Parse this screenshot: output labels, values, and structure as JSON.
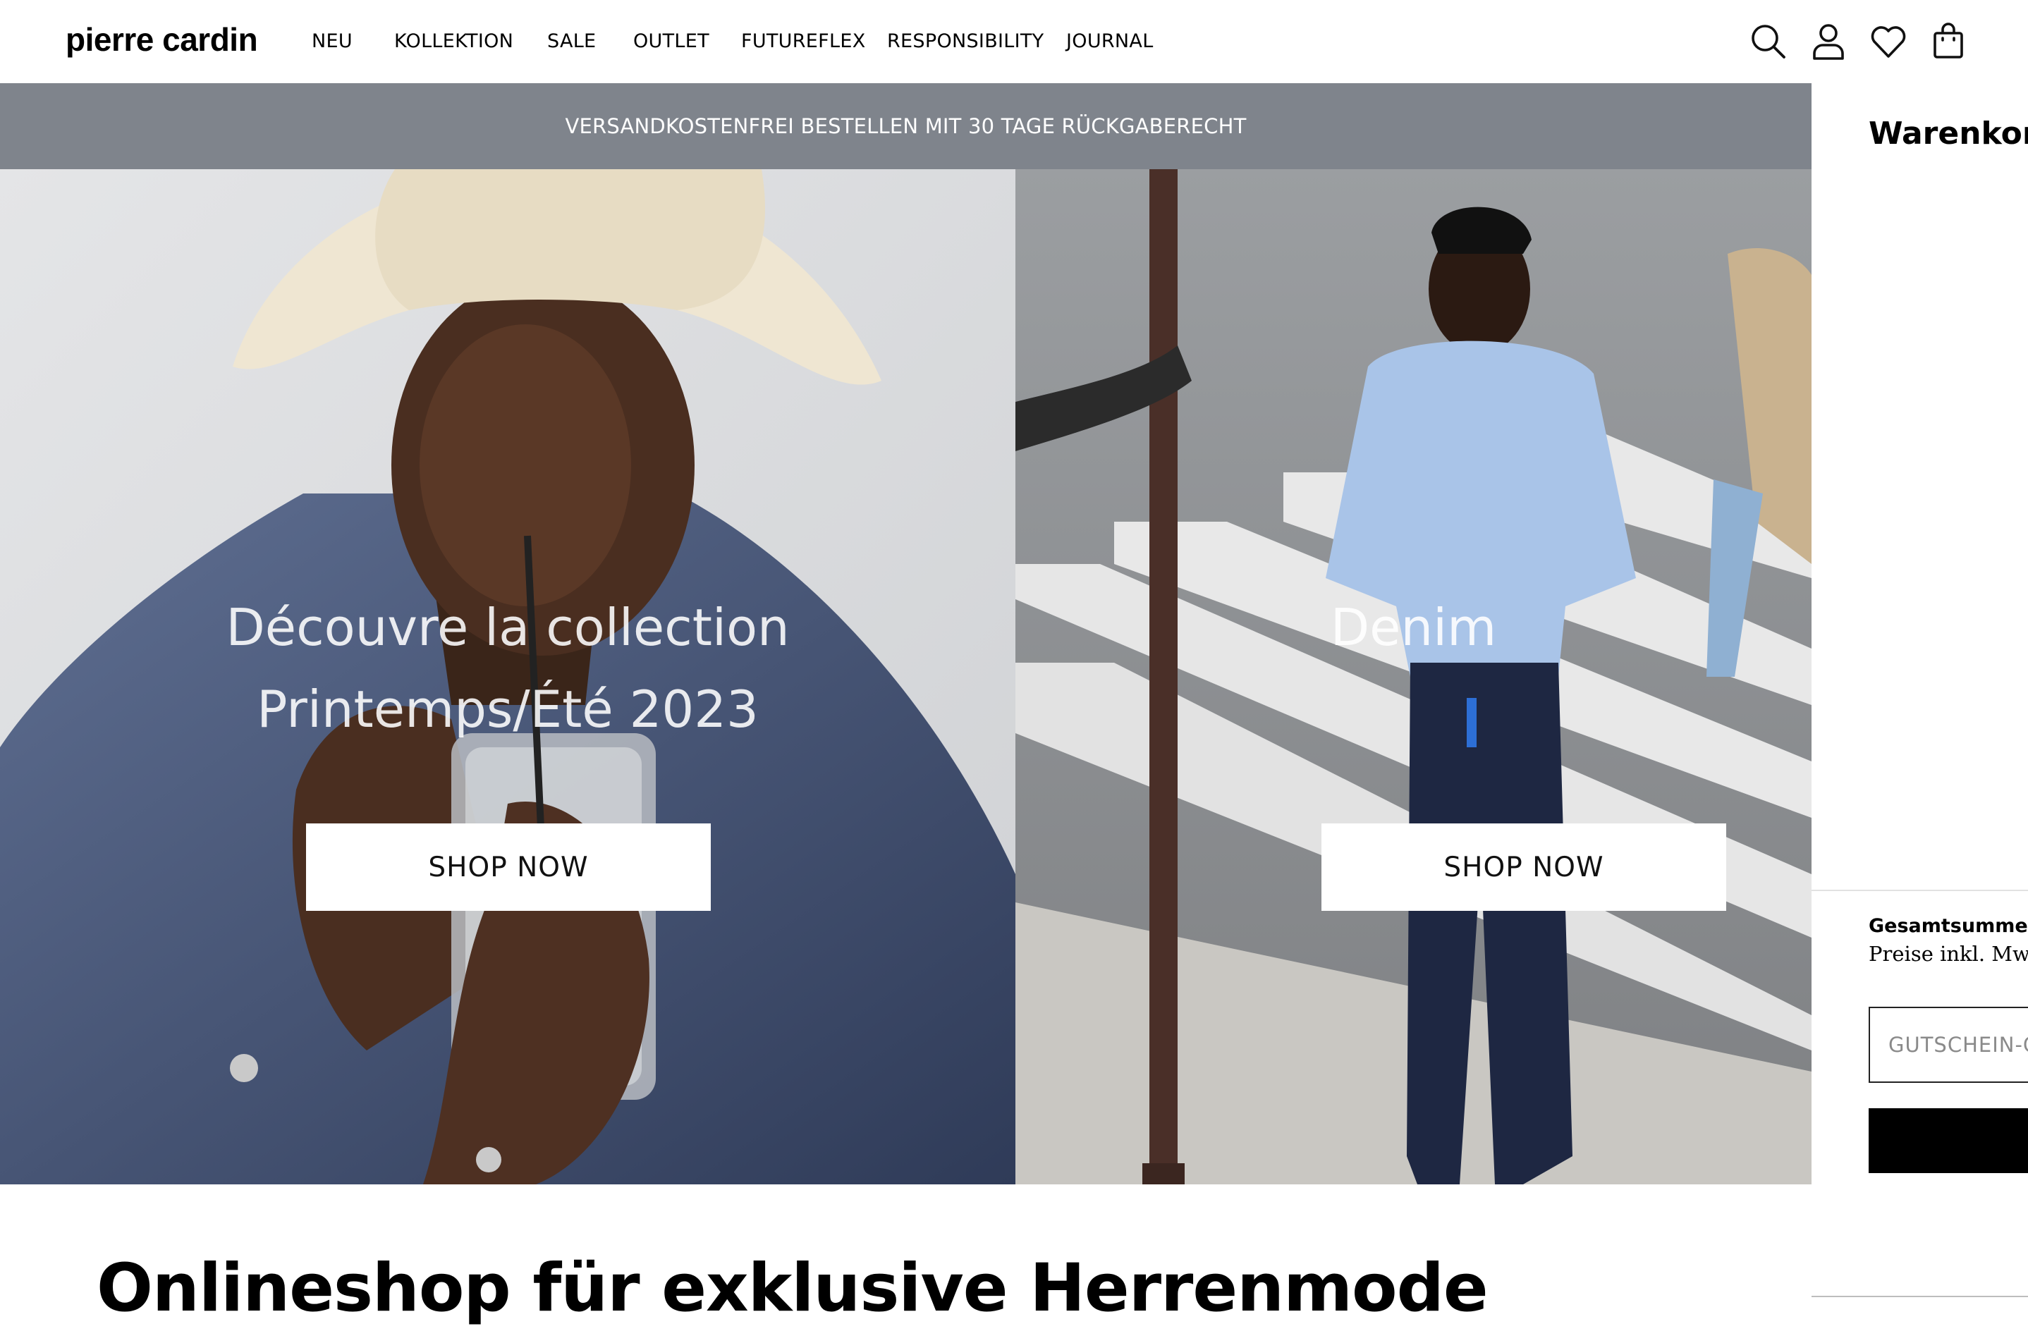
{
  "header": {
    "logo": "pierre cardin",
    "nav": [
      {
        "label": "NEU"
      },
      {
        "label": "KOLLEKTION"
      },
      {
        "label": "SALE"
      },
      {
        "label": "OUTLET"
      },
      {
        "label": "FUTUREFLEX"
      },
      {
        "label": "RESPONSIBILITY"
      },
      {
        "label": "JOURNAL"
      }
    ],
    "icons": [
      "search-icon",
      "account-icon",
      "wishlist-heart-icon",
      "shopping-bag-icon"
    ]
  },
  "promo": {
    "text": "VERSANDKOSTENFREI BESTELLEN MIT 30 TAGE RÜCKGABERECHT"
  },
  "hero": {
    "left": {
      "title_line1": "Découvre la collection",
      "title_line2": "Printemps/Été 2023",
      "button": "SHOP NOW"
    },
    "right": {
      "title": "Denim",
      "button": "SHOP NOW"
    }
  },
  "cart": {
    "title": "Warenkorb",
    "total_label": "Gesamtsumme",
    "tax_note": "Preise inkl. MwSt.,",
    "coupon_placeholder": "GUTSCHEIN-CODE"
  },
  "main": {
    "heading": "Onlineshop für exklusive Herrenmode"
  },
  "colors": {
    "promo_bar": "#7f848c",
    "button_bg": "#ffffff",
    "checkout_button": "#000000"
  }
}
